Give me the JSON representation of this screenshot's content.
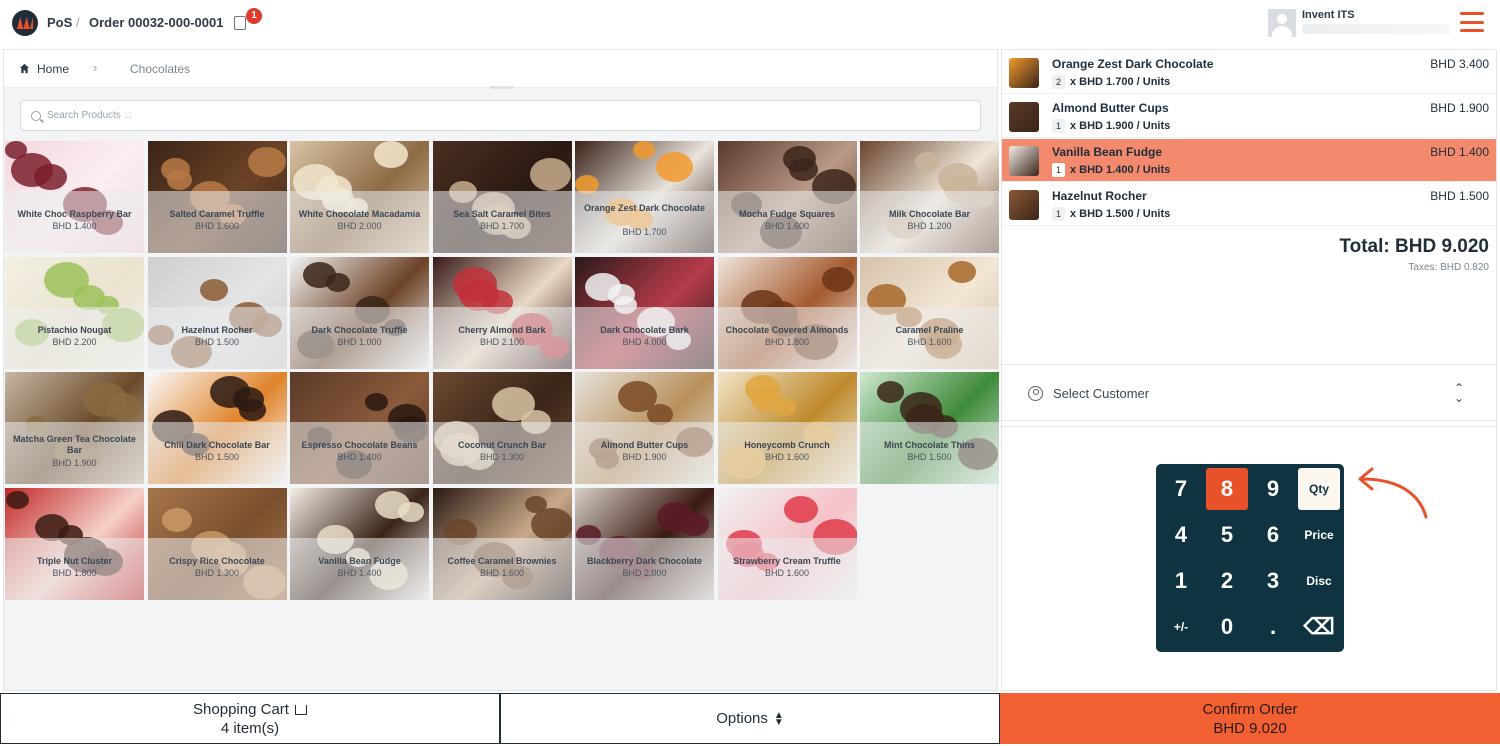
{
  "header": {
    "app_name": "PoS",
    "separator": "/",
    "order_title": "Order 00032-000-0001",
    "order_badge": "1",
    "user_name": "Invent ITS"
  },
  "breadcrumb": {
    "home": "Home",
    "category": "Chocolates"
  },
  "search": {
    "placeholder": "Search Products ..."
  },
  "products": [
    {
      "name": "White Choc Raspberry Bar",
      "price": "BHD 1.400"
    },
    {
      "name": "Salted Caramel Truffle",
      "price": "BHD 1.600"
    },
    {
      "name": "White Chocolate Macadamia",
      "price": "BHD 2.000"
    },
    {
      "name": "Sea Salt Caramel Bites",
      "price": "BHD 1.700"
    },
    {
      "name": "Orange Zest Dark Chocolate",
      "price": "BHD 1.700"
    },
    {
      "name": "Mocha Fudge Squares",
      "price": "BHD 1.600"
    },
    {
      "name": "Milk Chocolate Bar",
      "price": "BHD 1.200"
    },
    {
      "name": "Pistachio Nougat",
      "price": "BHD 2.200"
    },
    {
      "name": "Hazelnut Rocher",
      "price": "BHD 1.500"
    },
    {
      "name": "Dark Chocolate Truffle",
      "price": "BHD 1.000"
    },
    {
      "name": "Cherry Almond Bark",
      "price": "BHD 2.100"
    },
    {
      "name": "Dark Chocolate Bark",
      "price": "BHD 4.000"
    },
    {
      "name": "Chocolate Covered Almonds",
      "price": "BHD 1.800"
    },
    {
      "name": "Caramel Praline",
      "price": "BHD 1.600"
    },
    {
      "name": "Matcha Green Tea Chocolate Bar",
      "price": "BHD 1.900"
    },
    {
      "name": "Chili Dark Chocolate Bar",
      "price": "BHD 1.500"
    },
    {
      "name": "Espresso Chocolate Beans",
      "price": "BHD 1.400"
    },
    {
      "name": "Coconut Crunch Bar",
      "price": "BHD 1.300"
    },
    {
      "name": "Almond Butter Cups",
      "price": "BHD 1.900"
    },
    {
      "name": "Honeycomb Crunch",
      "price": "BHD 1.600"
    },
    {
      "name": "Mint Chocolate Thins",
      "price": "BHD 1.500"
    },
    {
      "name": "Triple Nut Cluster",
      "price": "BHD 1.800"
    },
    {
      "name": "Crispy Rice Chocolate",
      "price": "BHD 1.300"
    },
    {
      "name": "Vanilla Bean Fudge",
      "price": "BHD 1.400"
    },
    {
      "name": "Coffee Caramel Brownies",
      "price": "BHD 1.600"
    },
    {
      "name": "Blackberry Dark Chocolate",
      "price": "BHD 2.000"
    },
    {
      "name": "Strawberry Cream Truffle",
      "price": "BHD 1.600"
    }
  ],
  "order_lines": [
    {
      "name": "Orange Zest Dark Chocolate",
      "total": "BHD 3.400",
      "qty": "2",
      "unit": "x BHD 1.700 / Units"
    },
    {
      "name": "Almond Butter Cups",
      "total": "BHD 1.900",
      "qty": "1",
      "unit": "x BHD 1.900 / Units"
    },
    {
      "name": "Vanilla Bean Fudge",
      "total": "BHD 1.400",
      "qty": "1",
      "unit": "x BHD 1.400 / Units"
    },
    {
      "name": "Hazelnut Rocher",
      "total": "BHD 1.500",
      "qty": "1",
      "unit": "x BHD 1.500 / Units"
    }
  ],
  "summary": {
    "total": "Total: BHD 9.020",
    "taxes": "Taxes: BHD 0.820"
  },
  "customer": {
    "label": "Select Customer"
  },
  "numpad": {
    "keys": [
      "7",
      "8",
      "9",
      "Qty",
      "4",
      "5",
      "6",
      "Price",
      "1",
      "2",
      "3",
      "Disc",
      "+/-",
      "0",
      ".",
      "⌫"
    ]
  },
  "bottom_bar": {
    "cart_label": "Shopping Cart",
    "cart_count": "4 item(s)",
    "options_label": "Options",
    "confirm_label": "Confirm Order",
    "confirm_total": "BHD 9.020"
  },
  "colors": {
    "accent": "#e8522b",
    "selected_line": "#f48a6d",
    "numpad_bg": "#0f3340",
    "confirm_bg": "#f26032"
  }
}
